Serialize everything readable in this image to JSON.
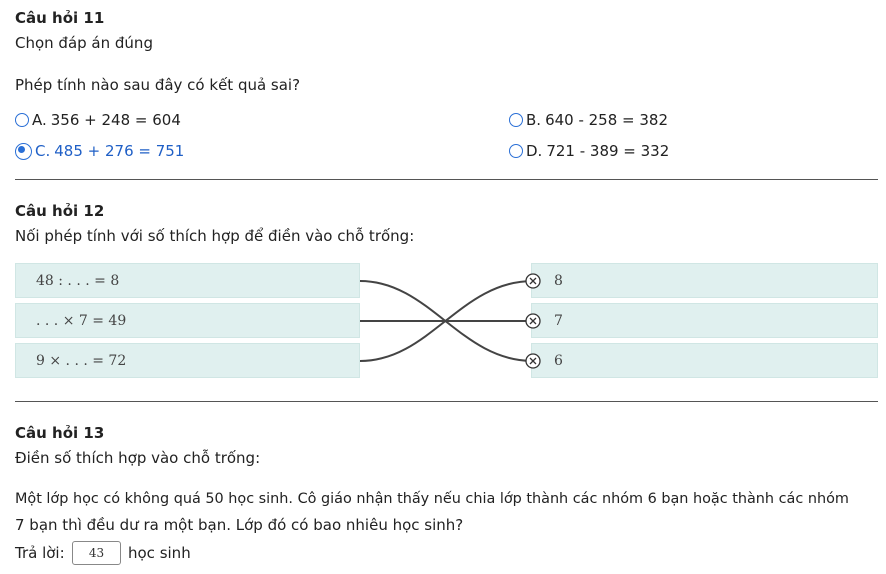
{
  "q11": {
    "title": "Câu hỏi 11",
    "instruction": "Chọn đáp án đúng",
    "question": "Phép tính nào sau đây có kết quả sai?",
    "options": [
      {
        "letter": "A.",
        "text": "356 + 248 = 604",
        "selected": false
      },
      {
        "letter": "B.",
        "text": "640 - 258 = 382",
        "selected": false
      },
      {
        "letter": "C.",
        "text": "485 + 276 = 751",
        "selected": true
      },
      {
        "letter": "D.",
        "text": "721 - 389 = 332",
        "selected": false
      }
    ]
  },
  "q12": {
    "title": "Câu hỏi 12",
    "instruction": "Nối phép tính với số thích hợp để điền vào chỗ trống:",
    "left_items": [
      "48 : . . . = 8",
      ". . . × 7 = 49",
      "9 × . . . = 72"
    ],
    "right_items": [
      "8",
      "7",
      "6"
    ],
    "connections": [
      [
        0,
        2
      ],
      [
        1,
        1
      ],
      [
        2,
        0
      ]
    ]
  },
  "q13": {
    "title": "Câu hỏi 13",
    "instruction": "Điền số thích hợp vào chỗ trống:",
    "problem_line1": "Một lớp học có không quá 50 học sinh. Cô giáo nhận thấy nếu chia lớp thành các nhóm 6 bạn hoặc thành các nhóm",
    "problem_line2": "7 bạn thì đều dư ra một bạn. Lớp đó có bao nhiêu học sinh?",
    "answer_label": "Trả lời:",
    "answer_value": "43",
    "answer_unit": "học sinh"
  },
  "colors": {
    "accent": "#2a6fd6",
    "match_box": "#e0f0ef",
    "line": "#444444"
  }
}
